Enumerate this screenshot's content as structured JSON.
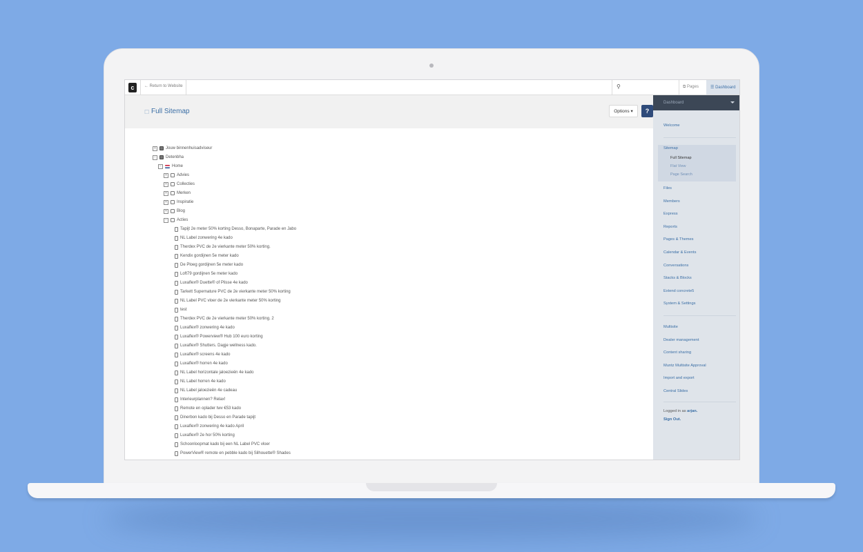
{
  "toolbar": {
    "logo": "c",
    "return_label": "Return to Website",
    "pages_label": "Pages",
    "dashboard_label": "Dashboard"
  },
  "header": {
    "title": "Full Sitemap",
    "options_label": "Options",
    "help_label": "?"
  },
  "tree": {
    "sites": [
      {
        "label": "Jouw binnenhuisadviseur",
        "expanded": false
      },
      {
        "label": "Detenbha",
        "expanded": true
      }
    ],
    "home_label": "Home",
    "folders": [
      "Advies",
      "Collecties",
      "Merken",
      "Inspiratie",
      "Blog",
      "Acties"
    ],
    "pages": [
      "Tapijt 2e meter 50% korting Desso, Bonaparte, Parade en Jabo",
      "NL Label zonwering 4e kado",
      "Therdex PVC de 2e vierkante meter 50% korting.",
      "Kendix gordijnen 5e meter kado",
      "De Ploeg gordijnen 5e meter kado",
      "Loft79 gordijnen 5e meter kado",
      "Luxaflex® Duette® of Plisse 4e kado",
      "Tarkett Supernature PVC de 2e vierkante meter 50% korting",
      "NL Label PVC vloer de 2e vierkante meter 50% korting",
      "test",
      "Therdex PVC de 2e vierkante meter 50% korting. 2",
      "Luxaflex® zonwering 4e kado",
      "Luxaflex® Powerview® Hub 100 euro korting",
      "Luxaflex® Shutters. Dagje wellness kado.",
      "Luxaflex® screens 4e kado",
      "Luxaflex® horren 4e kado",
      "NL Label horizontale jaloezieën 4e kado",
      "NL Label horren 4e kado",
      "NL Label jaloezieën 4e cadeau",
      "Interieurplannen? Relax!",
      "Remote en oplader twv €53 kado",
      "Dinerbon kado bij Desso en Parade tapijt",
      "Luxaflex® zonwering 4e kado April",
      "Luxaflex® 2e hor 50% korting",
      "Schoonloopmat kado bij een NL Label PVC vloer",
      "PowerView® remote en pebble kado bij Silhouette® Shades"
    ]
  },
  "sidebar": {
    "header": "Dashboard",
    "welcome": "Welcome",
    "sitemap": "Sitemap",
    "sitemap_sub": [
      "Full Sitemap",
      "Flat View",
      "Page Search"
    ],
    "items": [
      "Files",
      "Members",
      "Express",
      "Reports",
      "Pages & Themes",
      "Calendar & Events",
      "Conversations",
      "Stacks & Blocks",
      "Extend concrete5",
      "System & Settings"
    ],
    "extra_items": [
      "Multisite",
      "Dealer management",
      "Content sharing",
      "Muntz Multisite Approval",
      "Import and export",
      "Central Slides"
    ],
    "logged_in_prefix": "Logged in as",
    "username": "arjan.",
    "sign_out": "Sign Out."
  },
  "colors": {
    "background": "#7eaae6",
    "accent": "#3a6ea5",
    "sidebar_bg": "#dfe4ea",
    "sidebar_header": "#3c4756",
    "help_button": "#2f4b7a"
  }
}
